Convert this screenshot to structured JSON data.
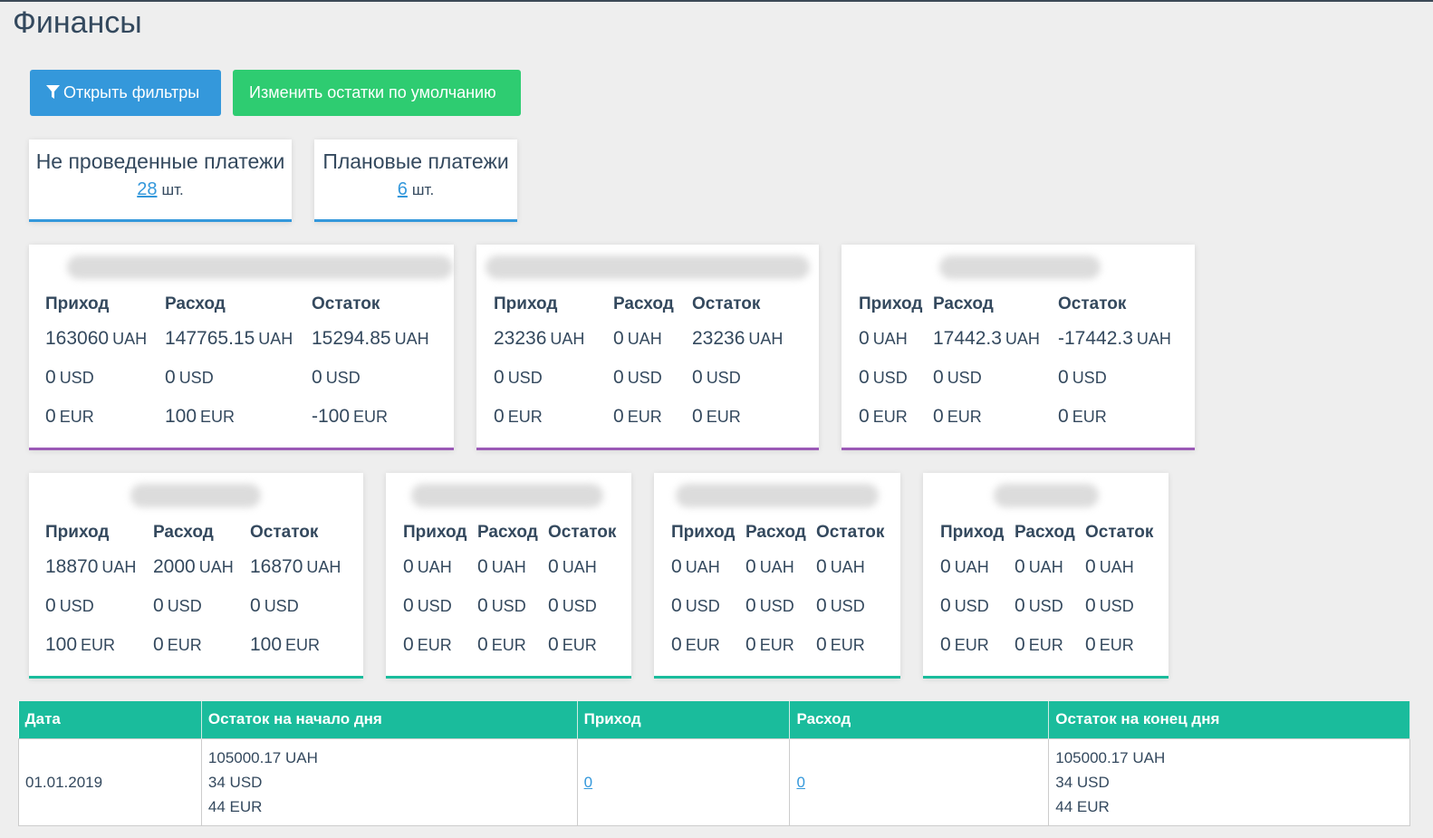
{
  "page": {
    "title": "Финансы"
  },
  "toolbar": {
    "filters_label": "Открыть фильтры",
    "defaults_label": "Изменить остатки по умолчанию"
  },
  "summary": [
    {
      "title": "Не проведенные платежи",
      "count": "28",
      "unit": "шт."
    },
    {
      "title": "Плановые платежи",
      "count": "6",
      "unit": "шт."
    }
  ],
  "labels": {
    "income": "Приход",
    "expense": "Расход",
    "balance": "Остаток"
  },
  "accounts": [
    {
      "rows": [
        [
          "163060",
          "UAH",
          "147765.15",
          "UAH",
          "15294.85",
          "UAH"
        ],
        [
          "0",
          "USD",
          "0",
          "USD",
          "0",
          "USD"
        ],
        [
          "0",
          "EUR",
          "100",
          "EUR",
          "-100",
          "EUR"
        ]
      ]
    },
    {
      "rows": [
        [
          "23236",
          "UAH",
          "0",
          "UAH",
          "23236",
          "UAH"
        ],
        [
          "0",
          "USD",
          "0",
          "USD",
          "0",
          "USD"
        ],
        [
          "0",
          "EUR",
          "0",
          "EUR",
          "0",
          "EUR"
        ]
      ]
    },
    {
      "rows": [
        [
          "0",
          "UAH",
          "17442.3",
          "UAH",
          "-17442.3",
          "UAH"
        ],
        [
          "0",
          "USD",
          "0",
          "USD",
          "0",
          "USD"
        ],
        [
          "0",
          "EUR",
          "0",
          "EUR",
          "0",
          "EUR"
        ]
      ]
    },
    {
      "rows": [
        [
          "18870",
          "UAH",
          "2000",
          "UAH",
          "16870",
          "UAH"
        ],
        [
          "0",
          "USD",
          "0",
          "USD",
          "0",
          "USD"
        ],
        [
          "100",
          "EUR",
          "0",
          "EUR",
          "100",
          "EUR"
        ]
      ]
    },
    {
      "rows": [
        [
          "0",
          "UAH",
          "0",
          "UAH",
          "0",
          "UAH"
        ],
        [
          "0",
          "USD",
          "0",
          "USD",
          "0",
          "USD"
        ],
        [
          "0",
          "EUR",
          "0",
          "EUR",
          "0",
          "EUR"
        ]
      ]
    },
    {
      "rows": [
        [
          "0",
          "UAH",
          "0",
          "UAH",
          "0",
          "UAH"
        ],
        [
          "0",
          "USD",
          "0",
          "USD",
          "0",
          "USD"
        ],
        [
          "0",
          "EUR",
          "0",
          "EUR",
          "0",
          "EUR"
        ]
      ]
    },
    {
      "rows": [
        [
          "0",
          "UAH",
          "0",
          "UAH",
          "0",
          "UAH"
        ],
        [
          "0",
          "USD",
          "0",
          "USD",
          "0",
          "USD"
        ],
        [
          "0",
          "EUR",
          "0",
          "EUR",
          "0",
          "EUR"
        ]
      ]
    }
  ],
  "table": {
    "headers": [
      "Дата",
      "Остаток на начало дня",
      "Приход",
      "Расход",
      "Остаток на конец дня"
    ],
    "rows": [
      {
        "date": "01.01.2019",
        "start": [
          "105000.17 UAH",
          "34 USD",
          "44 EUR"
        ],
        "income": "0",
        "expense": "0",
        "end": [
          "105000.17 UAH",
          "34 USD",
          "44 EUR"
        ]
      }
    ]
  },
  "colors": {
    "primary": "#3498db",
    "success": "#2ecc71",
    "purple": "#9b59b6",
    "teal": "#1abc9c",
    "text": "#34495e"
  }
}
